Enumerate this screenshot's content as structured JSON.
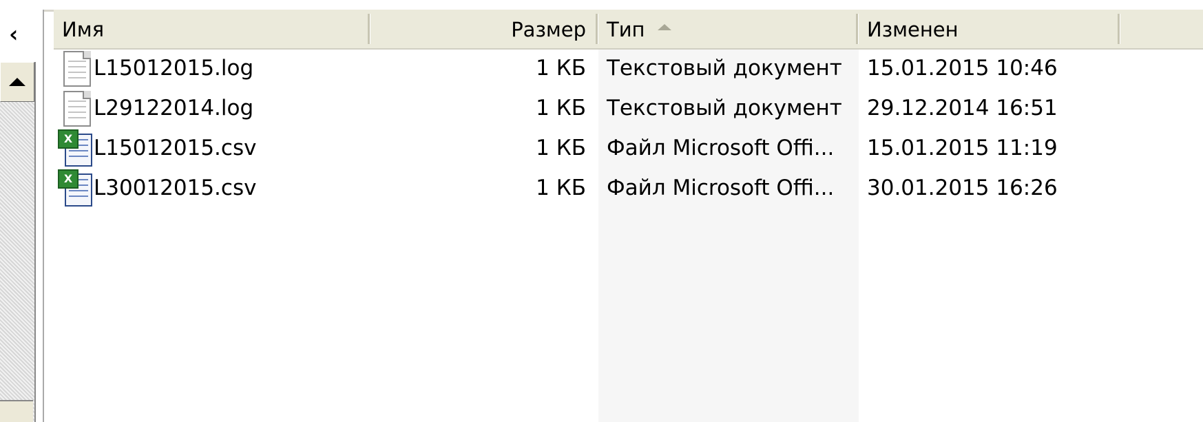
{
  "left_panel": {
    "collapse_glyph": "‹"
  },
  "columns": {
    "name": "Имя",
    "size": "Размер",
    "type": "Тип",
    "modified": "Изменен"
  },
  "files": [
    {
      "name": "L15012015.log",
      "size": "1 КБ",
      "type": "Текстовый документ",
      "modified": "15.01.2015 10:46",
      "icon": "text-document-icon"
    },
    {
      "name": "L29122014.log",
      "size": "1 КБ",
      "type": "Текстовый документ",
      "modified": "29.12.2014 16:51",
      "icon": "text-document-icon"
    },
    {
      "name": "L15012015.csv",
      "size": "1 КБ",
      "type": "Файл Microsoft Offi...",
      "modified": "15.01.2015 11:19",
      "icon": "excel-csv-icon"
    },
    {
      "name": "L30012015.csv",
      "size": "1 КБ",
      "type": "Файл Microsoft Offi...",
      "modified": "30.01.2015 16:26",
      "icon": "excel-csv-icon"
    }
  ]
}
